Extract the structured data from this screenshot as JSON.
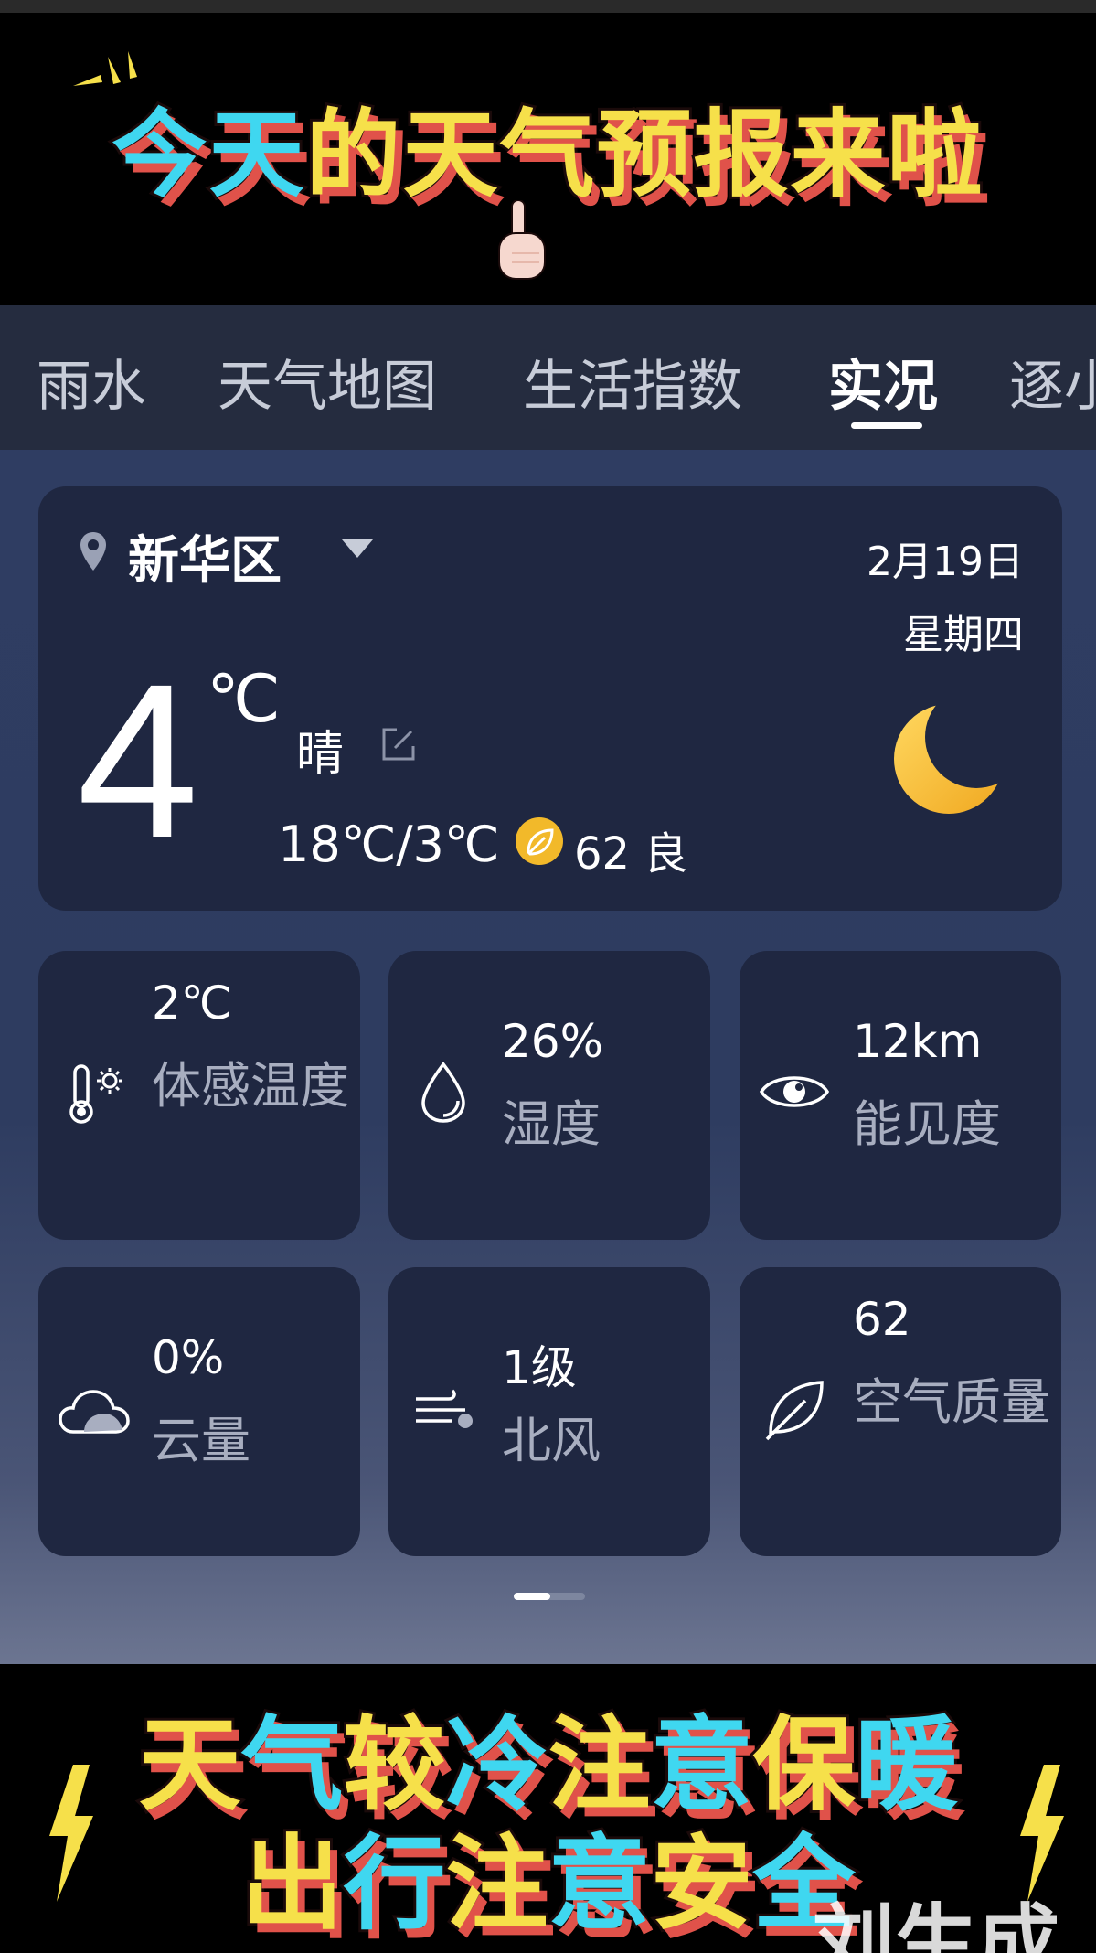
{
  "banner_top": {
    "segments": [
      {
        "text": "今",
        "color": "cyan"
      },
      {
        "text": "天",
        "color": "cyan"
      },
      {
        "text": "的",
        "color": "yellow"
      },
      {
        "text": "天",
        "color": "yellow"
      },
      {
        "text": "气",
        "color": "yellow"
      },
      {
        "text": "预",
        "color": "yellow"
      },
      {
        "text": "报",
        "color": "yellow"
      },
      {
        "text": "来",
        "color": "yellow"
      },
      {
        "text": "啦",
        "color": "yellow"
      }
    ]
  },
  "tabs": {
    "items": [
      {
        "label": "雨水"
      },
      {
        "label": "天气地图"
      },
      {
        "label": "生活指数"
      },
      {
        "label": "实况",
        "active": true
      },
      {
        "label": "逐小"
      }
    ]
  },
  "current": {
    "location": "新华区",
    "date": "2月19日",
    "weekday": "星期四",
    "temperature": "4",
    "unit": "℃",
    "condition": "晴",
    "high_low": "18℃/3℃",
    "aqi": "62 良"
  },
  "details": [
    {
      "value": "2℃",
      "label": "体感温度",
      "icon": "thermometer-sun-icon"
    },
    {
      "value": "26%",
      "label": "湿度",
      "icon": "droplet-icon"
    },
    {
      "value": "12km",
      "label": "能见度",
      "icon": "eye-icon"
    },
    {
      "value": "0%",
      "label": "云量",
      "icon": "cloud-icon"
    },
    {
      "value": "1级",
      "label": "北风",
      "icon": "wind-icon"
    },
    {
      "value": "62",
      "label": "空气质量",
      "icon": "leaf-icon"
    }
  ],
  "banner_bottom": {
    "line1": "天气较冷注意保暖",
    "line2": "出行注意安全",
    "watermark": "刘生成"
  },
  "colors": {
    "accent_cyan": "#3fd7f0",
    "accent_yellow": "#f6e04a",
    "shadow_red": "#e0524a",
    "card": "#1f2741",
    "aqi_yellow": "#f2b92a"
  }
}
